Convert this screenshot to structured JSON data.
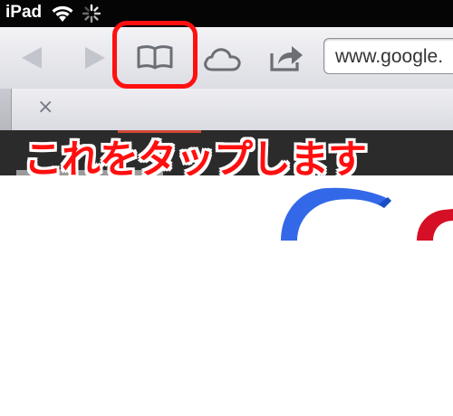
{
  "status_bar": {
    "carrier": "iPad"
  },
  "toolbar": {
    "url_text": "www.google.",
    "icons": [
      "back-arrow-icon",
      "forward-arrow-icon",
      "open-book-icon",
      "cloud-icon",
      "share-icon"
    ]
  },
  "tabs": {
    "close_label": "×"
  },
  "annotation": {
    "caption": "これをタップします",
    "highlight_color": "#ff1010"
  },
  "colors": {
    "status_bar": "#050505",
    "icon_gray": "#6c6e76",
    "google_blue": "#3369e8",
    "google_red": "#d50f25"
  }
}
